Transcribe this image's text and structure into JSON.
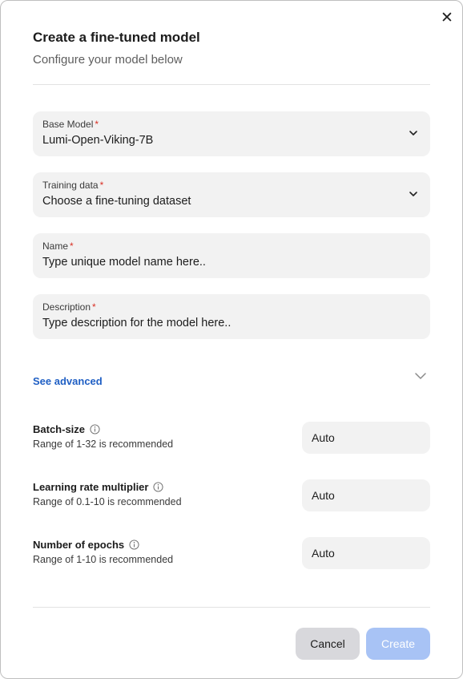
{
  "dialog": {
    "close_icon": "close-icon",
    "title": "Create a fine-tuned model",
    "subtitle": "Configure your model below"
  },
  "fields": {
    "base_model": {
      "label": "Base Model",
      "required_mark": "*",
      "value": "Lumi-Open-Viking-7B"
    },
    "training_data": {
      "label": "Training data",
      "required_mark": "*",
      "value": "Choose a fine-tuning dataset"
    },
    "name": {
      "label": "Name",
      "required_mark": "*",
      "placeholder": "Type unique model name here.."
    },
    "description": {
      "label": "Description",
      "required_mark": "*",
      "placeholder": "Type description for the model here.."
    }
  },
  "advanced": {
    "toggle_label": "See advanced",
    "params": [
      {
        "label": "Batch-size",
        "hint": "Range of 1-32 is recommended",
        "value": "Auto"
      },
      {
        "label": "Learning rate multiplier",
        "hint": "Range of 0.1-10 is recommended",
        "value": "Auto"
      },
      {
        "label": "Number of epochs",
        "hint": "Range of 1-10 is recommended",
        "value": "Auto"
      }
    ]
  },
  "footer": {
    "cancel_label": "Cancel",
    "create_label": "Create"
  },
  "colors": {
    "link": "#1f5fc4",
    "required": "#d93025",
    "create_disabled": "#a8c3f5",
    "cancel_bg": "#d8d8dc",
    "field_bg": "#f2f2f2"
  }
}
